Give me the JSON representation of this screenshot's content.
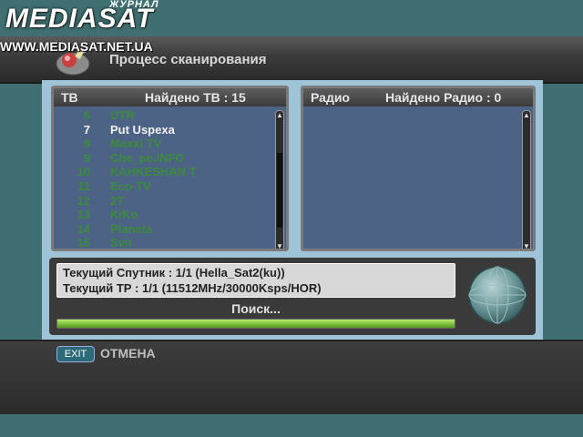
{
  "watermark": {
    "journal": "ЖУРНАЛ",
    "brand": "MEDIASAT",
    "url": "WWW.MEDIASAT.NET.UA"
  },
  "header": {
    "title": "Процесс сканирования",
    "icon": "satellite-dish-icon"
  },
  "tv_panel": {
    "label": "ТВ",
    "found": "Найдено ТВ : 15",
    "channels": [
      {
        "num": "6",
        "name": "UTR"
      },
      {
        "num": "7",
        "name": "Put Uspexa"
      },
      {
        "num": "8",
        "name": "Maxxi TV"
      },
      {
        "num": "9",
        "name": "Che_pe.INFO"
      },
      {
        "num": "10",
        "name": "KAHKESHAN T"
      },
      {
        "num": "11",
        "name": "Eco-TV"
      },
      {
        "num": "12",
        "name": "2T"
      },
      {
        "num": "13",
        "name": "KiKo"
      },
      {
        "num": "14",
        "name": "Planeta"
      },
      {
        "num": "15",
        "name": "Svit"
      }
    ],
    "highlighted_index": 1,
    "scroll_position": 0.67
  },
  "radio_panel": {
    "label": "Радио",
    "found": "Найдено Радио : 0",
    "channels": []
  },
  "status": {
    "satellite": "Текущий Спутник : 1/1  (Hella_Sat2(ku))",
    "tp": "Текущий ТР : 1/1  (11512MHz/30000Ksps/HOR)",
    "searching": "Поиск...",
    "progress": 1.0
  },
  "footer": {
    "exit_key": "EXIT",
    "exit_label": "ОТМЕНА"
  },
  "colors": {
    "background": "#3f6f70",
    "panel_bg": "#4c6385",
    "channel_text": "#3c8a3c",
    "highlight_text": "#f0f0f0",
    "progress": "#7ed03a"
  }
}
